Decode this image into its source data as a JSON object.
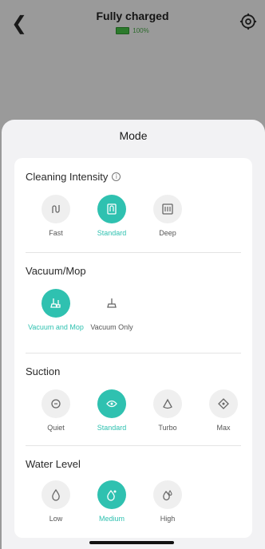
{
  "header": {
    "title": "Fully charged",
    "battery_percent": "100%"
  },
  "sheet": {
    "title": "Mode"
  },
  "cleaning_intensity": {
    "title": "Cleaning Intensity",
    "options": [
      {
        "label": "Fast",
        "icon": "fast-icon",
        "selected": false
      },
      {
        "label": "Standard",
        "icon": "standard-intensity-icon",
        "selected": true
      },
      {
        "label": "Deep",
        "icon": "deep-icon",
        "selected": false
      }
    ]
  },
  "vacuum_mop": {
    "title": "Vacuum/Mop",
    "options": [
      {
        "label": "Vacuum and Mop",
        "icon": "vacuum-and-mop-icon",
        "selected": true
      },
      {
        "label": "Vacuum Only",
        "icon": "vacuum-only-icon",
        "selected": false
      }
    ]
  },
  "suction": {
    "title": "Suction",
    "options": [
      {
        "label": "Quiet",
        "icon": "quiet-icon",
        "selected": false
      },
      {
        "label": "Standard",
        "icon": "standard-suction-icon",
        "selected": true
      },
      {
        "label": "Turbo",
        "icon": "turbo-icon",
        "selected": false
      },
      {
        "label": "Max",
        "icon": "max-icon",
        "selected": false
      }
    ]
  },
  "water_level": {
    "title": "Water Level",
    "options": [
      {
        "label": "Low",
        "icon": "water-low-icon",
        "selected": false
      },
      {
        "label": "Medium",
        "icon": "water-medium-icon",
        "selected": true
      },
      {
        "label": "High",
        "icon": "water-high-icon",
        "selected": false
      }
    ]
  },
  "colors": {
    "accent": "#2fc1b0",
    "backdrop": "#9a9a9a",
    "sheet": "#f2f2f4",
    "card": "#ffffff"
  }
}
